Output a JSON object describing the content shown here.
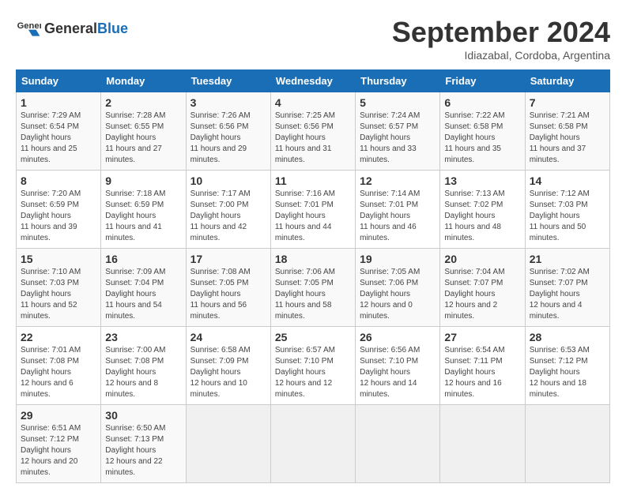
{
  "header": {
    "logo_general": "General",
    "logo_blue": "Blue",
    "month_title": "September 2024",
    "location": "Idiazabal, Cordoba, Argentina"
  },
  "weekdays": [
    "Sunday",
    "Monday",
    "Tuesday",
    "Wednesday",
    "Thursday",
    "Friday",
    "Saturday"
  ],
  "weeks": [
    [
      {
        "day": "1",
        "sunrise": "7:29 AM",
        "sunset": "6:54 PM",
        "daylight": "11 hours and 25 minutes."
      },
      {
        "day": "2",
        "sunrise": "7:28 AM",
        "sunset": "6:55 PM",
        "daylight": "11 hours and 27 minutes."
      },
      {
        "day": "3",
        "sunrise": "7:26 AM",
        "sunset": "6:56 PM",
        "daylight": "11 hours and 29 minutes."
      },
      {
        "day": "4",
        "sunrise": "7:25 AM",
        "sunset": "6:56 PM",
        "daylight": "11 hours and 31 minutes."
      },
      {
        "day": "5",
        "sunrise": "7:24 AM",
        "sunset": "6:57 PM",
        "daylight": "11 hours and 33 minutes."
      },
      {
        "day": "6",
        "sunrise": "7:22 AM",
        "sunset": "6:58 PM",
        "daylight": "11 hours and 35 minutes."
      },
      {
        "day": "7",
        "sunrise": "7:21 AM",
        "sunset": "6:58 PM",
        "daylight": "11 hours and 37 minutes."
      }
    ],
    [
      {
        "day": "8",
        "sunrise": "7:20 AM",
        "sunset": "6:59 PM",
        "daylight": "11 hours and 39 minutes."
      },
      {
        "day": "9",
        "sunrise": "7:18 AM",
        "sunset": "6:59 PM",
        "daylight": "11 hours and 41 minutes."
      },
      {
        "day": "10",
        "sunrise": "7:17 AM",
        "sunset": "7:00 PM",
        "daylight": "11 hours and 42 minutes."
      },
      {
        "day": "11",
        "sunrise": "7:16 AM",
        "sunset": "7:01 PM",
        "daylight": "11 hours and 44 minutes."
      },
      {
        "day": "12",
        "sunrise": "7:14 AM",
        "sunset": "7:01 PM",
        "daylight": "11 hours and 46 minutes."
      },
      {
        "day": "13",
        "sunrise": "7:13 AM",
        "sunset": "7:02 PM",
        "daylight": "11 hours and 48 minutes."
      },
      {
        "day": "14",
        "sunrise": "7:12 AM",
        "sunset": "7:03 PM",
        "daylight": "11 hours and 50 minutes."
      }
    ],
    [
      {
        "day": "15",
        "sunrise": "7:10 AM",
        "sunset": "7:03 PM",
        "daylight": "11 hours and 52 minutes."
      },
      {
        "day": "16",
        "sunrise": "7:09 AM",
        "sunset": "7:04 PM",
        "daylight": "11 hours and 54 minutes."
      },
      {
        "day": "17",
        "sunrise": "7:08 AM",
        "sunset": "7:05 PM",
        "daylight": "11 hours and 56 minutes."
      },
      {
        "day": "18",
        "sunrise": "7:06 AM",
        "sunset": "7:05 PM",
        "daylight": "11 hours and 58 minutes."
      },
      {
        "day": "19",
        "sunrise": "7:05 AM",
        "sunset": "7:06 PM",
        "daylight": "12 hours and 0 minutes."
      },
      {
        "day": "20",
        "sunrise": "7:04 AM",
        "sunset": "7:07 PM",
        "daylight": "12 hours and 2 minutes."
      },
      {
        "day": "21",
        "sunrise": "7:02 AM",
        "sunset": "7:07 PM",
        "daylight": "12 hours and 4 minutes."
      }
    ],
    [
      {
        "day": "22",
        "sunrise": "7:01 AM",
        "sunset": "7:08 PM",
        "daylight": "12 hours and 6 minutes."
      },
      {
        "day": "23",
        "sunrise": "7:00 AM",
        "sunset": "7:08 PM",
        "daylight": "12 hours and 8 minutes."
      },
      {
        "day": "24",
        "sunrise": "6:58 AM",
        "sunset": "7:09 PM",
        "daylight": "12 hours and 10 minutes."
      },
      {
        "day": "25",
        "sunrise": "6:57 AM",
        "sunset": "7:10 PM",
        "daylight": "12 hours and 12 minutes."
      },
      {
        "day": "26",
        "sunrise": "6:56 AM",
        "sunset": "7:10 PM",
        "daylight": "12 hours and 14 minutes."
      },
      {
        "day": "27",
        "sunrise": "6:54 AM",
        "sunset": "7:11 PM",
        "daylight": "12 hours and 16 minutes."
      },
      {
        "day": "28",
        "sunrise": "6:53 AM",
        "sunset": "7:12 PM",
        "daylight": "12 hours and 18 minutes."
      }
    ],
    [
      {
        "day": "29",
        "sunrise": "6:51 AM",
        "sunset": "7:12 PM",
        "daylight": "12 hours and 20 minutes."
      },
      {
        "day": "30",
        "sunrise": "6:50 AM",
        "sunset": "7:13 PM",
        "daylight": "12 hours and 22 minutes."
      },
      null,
      null,
      null,
      null,
      null
    ]
  ]
}
